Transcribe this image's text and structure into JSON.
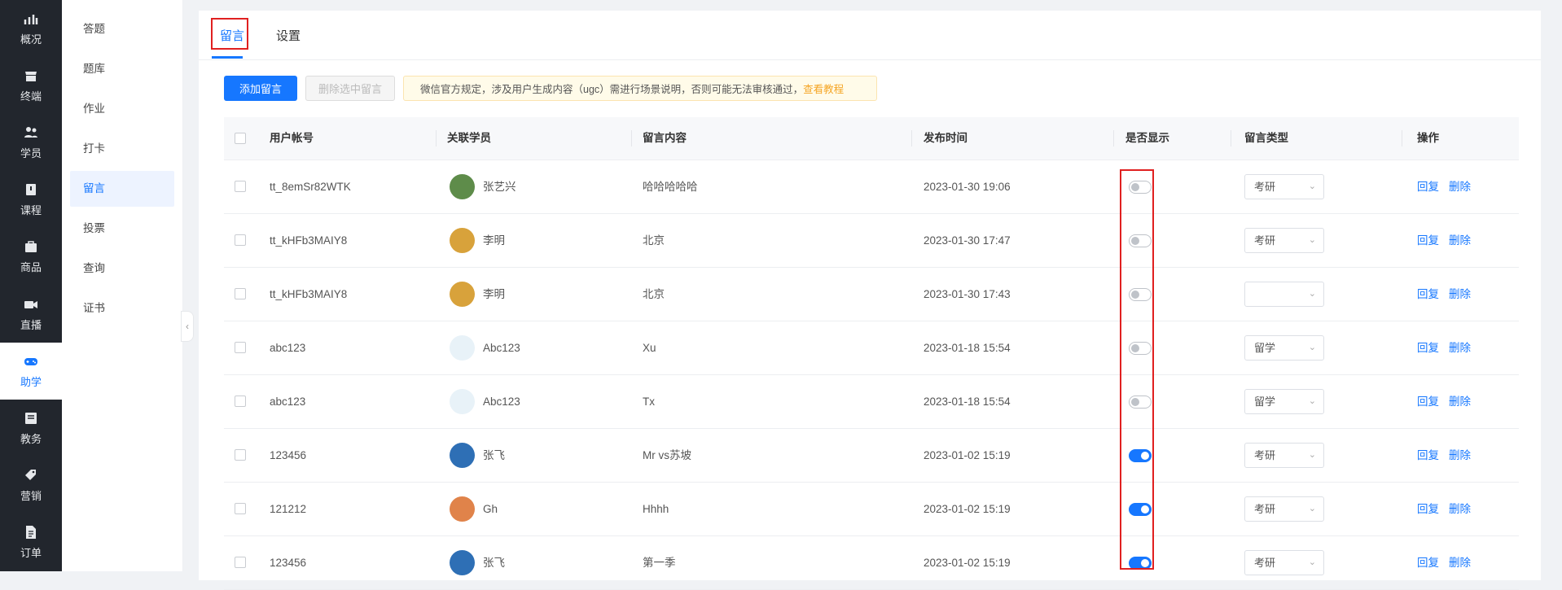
{
  "rail": {
    "items": [
      {
        "label": "概况",
        "icon": "chart-icon"
      },
      {
        "label": "终端",
        "icon": "store-icon"
      },
      {
        "label": "学员",
        "icon": "users-icon"
      },
      {
        "label": "课程",
        "icon": "book-icon"
      },
      {
        "label": "商品",
        "icon": "bag-icon"
      },
      {
        "label": "直播",
        "icon": "video-icon"
      },
      {
        "label": "助学",
        "icon": "gamepad-icon"
      },
      {
        "label": "教务",
        "icon": "clipboard-icon"
      },
      {
        "label": "营销",
        "icon": "tag-icon"
      },
      {
        "label": "订单",
        "icon": "document-icon"
      }
    ],
    "active_index": 6
  },
  "subnav": {
    "items": [
      "答题",
      "题库",
      "作业",
      "打卡",
      "留言",
      "投票",
      "查询",
      "证书"
    ],
    "active_index": 4
  },
  "tabs": {
    "messages": "留言",
    "settings": "设置"
  },
  "toolbar": {
    "add_label": "添加留言",
    "delete_label": "删除选中留言",
    "notice_text": "微信官方规定，涉及用户生成内容（ugc）需进行场景说明，否则可能无法审核通过，",
    "notice_link": "查看教程"
  },
  "table": {
    "headers": {
      "account": "用户帐号",
      "student": "关联学员",
      "content": "留言内容",
      "time": "发布时间",
      "visible": "是否显示",
      "type": "留言类型",
      "action": "操作"
    },
    "reply_label": "回复",
    "delete_label": "删除",
    "rows": [
      {
        "account": "tt_8emSr82WTK",
        "student": "张艺兴",
        "content": "哈哈哈哈哈",
        "time": "2023-01-30 19:06",
        "visible": false,
        "type": "考研",
        "avatar_color": "#5e8c4a"
      },
      {
        "account": "tt_kHFb3MAIY8",
        "student": "李明",
        "content": "北京",
        "time": "2023-01-30 17:47",
        "visible": false,
        "type": "考研",
        "avatar_color": "#d8a23b"
      },
      {
        "account": "tt_kHFb3MAIY8",
        "student": "李明",
        "content": "北京",
        "time": "2023-01-30 17:43",
        "visible": false,
        "type": "",
        "avatar_color": "#d8a23b"
      },
      {
        "account": "abc123",
        "student": "Abc123",
        "content": "Xu",
        "time": "2023-01-18 15:54",
        "visible": false,
        "type": "留学",
        "avatar_color": "#e8f2f8"
      },
      {
        "account": "abc123",
        "student": "Abc123",
        "content": "Tx",
        "time": "2023-01-18 15:54",
        "visible": false,
        "type": "留学",
        "avatar_color": "#e8f2f8"
      },
      {
        "account": "123456",
        "student": "张飞",
        "content": "Mr vs苏坡",
        "time": "2023-01-02 15:19",
        "visible": true,
        "type": "考研",
        "avatar_color": "#2e6fb5"
      },
      {
        "account": "121212",
        "student": "Gh",
        "content": "Hhhh",
        "time": "2023-01-02 15:19",
        "visible": true,
        "type": "考研",
        "avatar_color": "#e0834a"
      },
      {
        "account": "123456",
        "student": "张飞",
        "content": "第一季",
        "time": "2023-01-02 15:19",
        "visible": true,
        "type": "考研",
        "avatar_color": "#2e6fb5"
      }
    ]
  }
}
